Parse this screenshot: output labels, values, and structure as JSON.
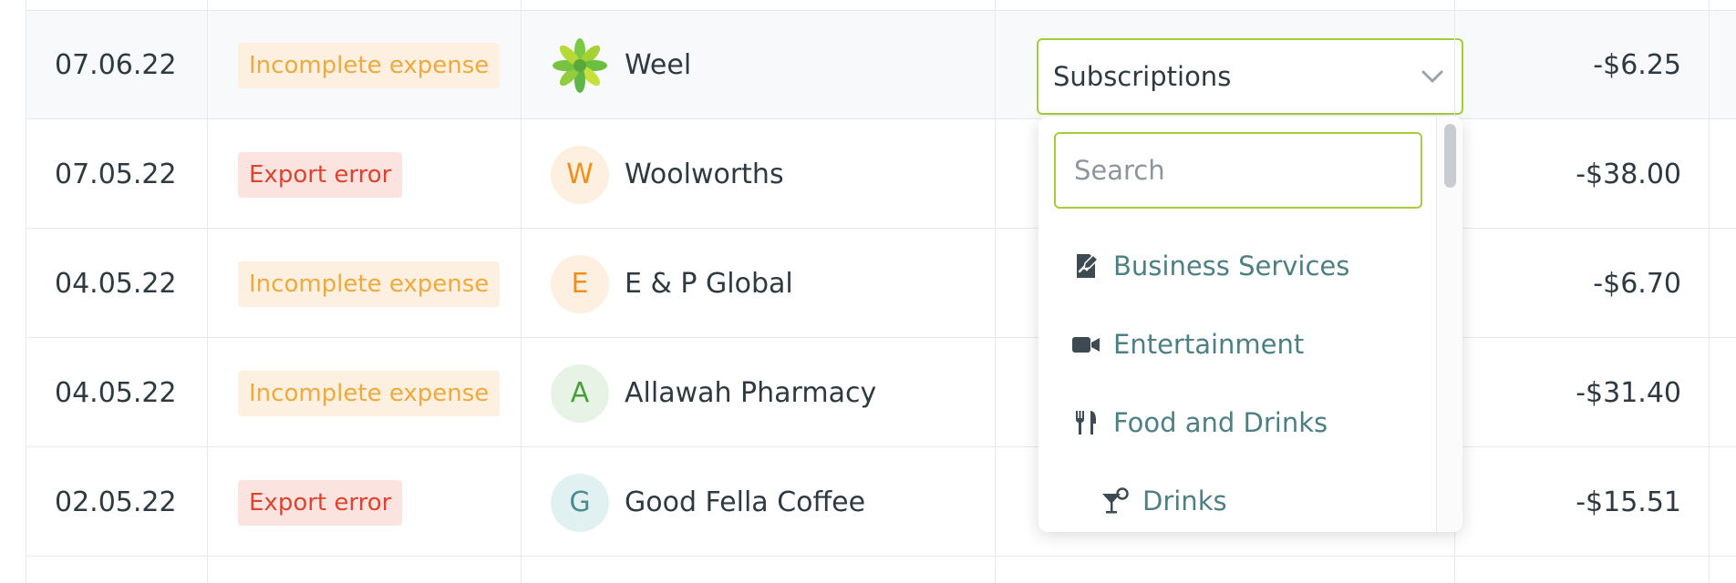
{
  "rows": [
    {
      "date": "07.06.22",
      "status": "Incomplete expense",
      "status_type": "incomplete",
      "merchant": "Weel",
      "avatar": "",
      "avatar_style": "logo",
      "amount": "-$6.25"
    },
    {
      "date": "07.05.22",
      "status": "Export error",
      "status_type": "error",
      "merchant": "Woolworths",
      "avatar": "W",
      "avatar_style": "orange",
      "amount": "-$38.00"
    },
    {
      "date": "04.05.22",
      "status": "Incomplete expense",
      "status_type": "incomplete",
      "merchant": "E & P Global",
      "avatar": "E",
      "avatar_style": "orange",
      "amount": "-$6.70"
    },
    {
      "date": "04.05.22",
      "status": "Incomplete expense",
      "status_type": "incomplete",
      "merchant": "Allawah Pharmacy",
      "avatar": "A",
      "avatar_style": "green",
      "amount": "-$31.40"
    },
    {
      "date": "02.05.22",
      "status": "Export error",
      "status_type": "error",
      "merchant": "Good Fella Coffee",
      "avatar": "G",
      "avatar_style": "teal",
      "amount": "-$15.51"
    }
  ],
  "category_select": {
    "value": "Subscriptions",
    "icon": "chevron-down-icon"
  },
  "dropdown": {
    "search_placeholder": "Search",
    "search_value": "",
    "options": [
      {
        "label": "Business Services",
        "icon": "business-services-icon"
      },
      {
        "label": "Entertainment",
        "icon": "video-camera-icon"
      },
      {
        "label": "Food and Drinks",
        "icon": "fork-knife-icon"
      },
      {
        "label": "Drinks",
        "icon": "cocktail-icon"
      }
    ]
  },
  "colors": {
    "accent": "#a4cd3a",
    "incomplete_text": "#f0a93c",
    "incomplete_bg": "#fdf0e0",
    "error_text": "#e0432d",
    "error_bg": "#fbe4e0",
    "option_text": "#4d7f83"
  }
}
